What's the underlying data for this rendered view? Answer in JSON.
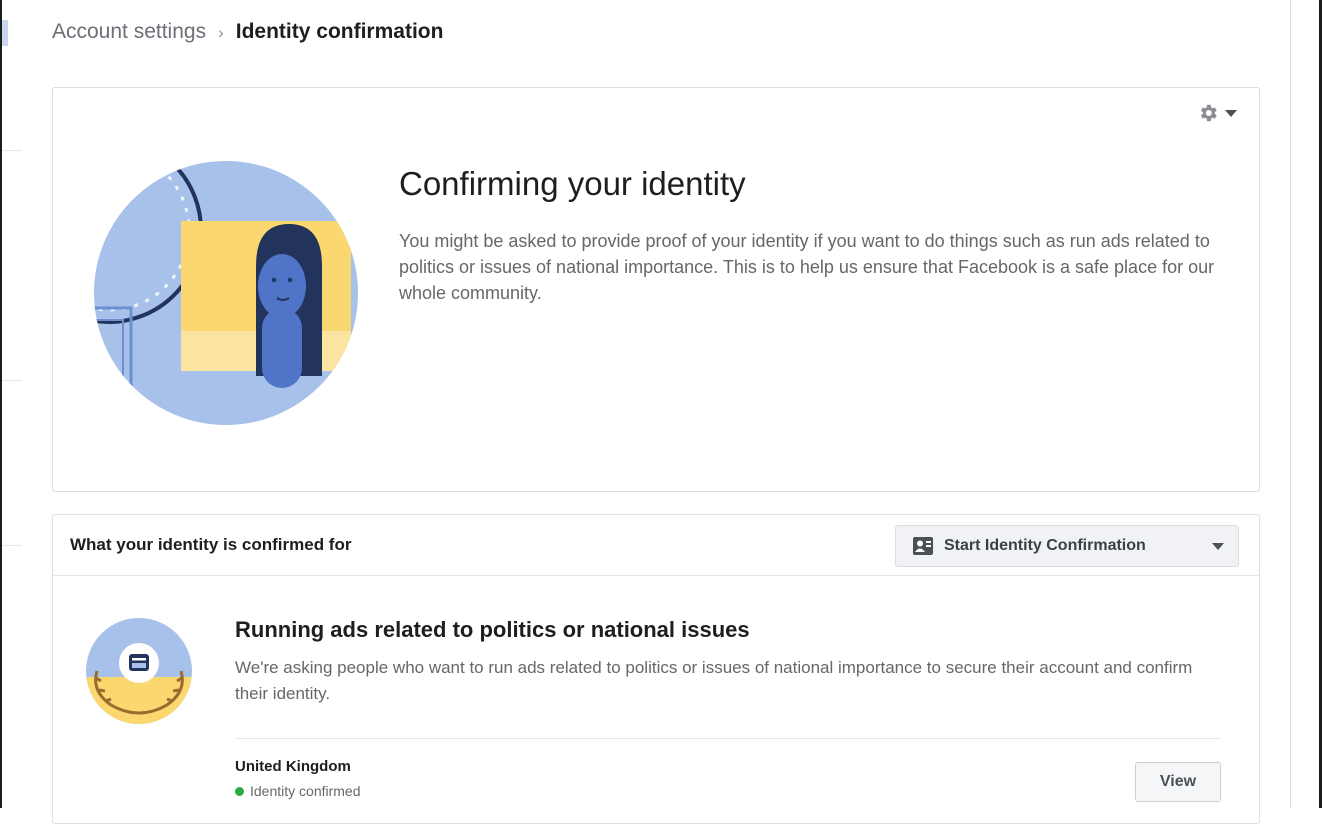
{
  "breadcrumb": {
    "parent": "Account settings",
    "separator": "›",
    "current": "Identity confirmation"
  },
  "hero": {
    "title": "Confirming your identity",
    "description": "You might be asked to provide proof of your identity if you want to do things such as run ads related to politics or issues of national importance. This is to help us ensure that Facebook is a safe place for our whole community.",
    "settings_icon": "gear-icon"
  },
  "confirmed_for": {
    "header": "What your identity is confirmed for",
    "start_button_label": "Start Identity Confirmation",
    "start_button_icon": "id-card-icon",
    "item": {
      "title": "Running ads related to politics or national issues",
      "description": "We're asking people who want to run ads related to politics or issues of national importance to secure their account and confirm their identity.",
      "country": "United Kingdom",
      "status": "Identity confirmed",
      "view_label": "View"
    }
  },
  "colors": {
    "illustration_blue": "#a8c1ea",
    "illustration_yellow": "#fad76f",
    "illustration_navy": "#22335c",
    "status_green": "#2aa841"
  }
}
